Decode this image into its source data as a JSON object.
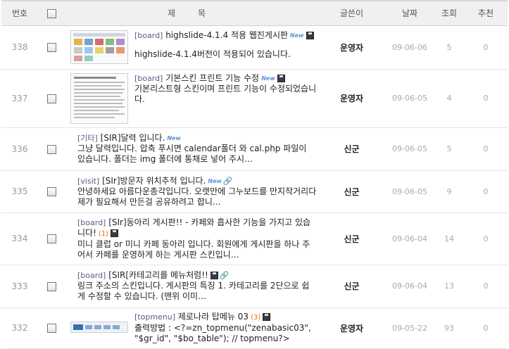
{
  "header": {
    "num": "번호",
    "title": "제 목",
    "writer": "글쓴이",
    "date": "날짜",
    "hits": "조회",
    "recommend": "추천"
  },
  "posts": [
    {
      "num": "338",
      "category": "[board]",
      "title": "highslide-4.1.4 적용 웹진게시판",
      "comments": "",
      "new": "New",
      "body": "highslide-4.1.4버전이 적용되어 있습니다.",
      "writer": "운영자",
      "date": "09-06-06",
      "hits": "5",
      "rec": "0"
    },
    {
      "num": "337",
      "category": "[board]",
      "title": "기본스킨 프린트 기능 수정",
      "comments": "",
      "new": "New",
      "body": "기본리스트형 스킨이며 프린트 기능이 수정되었습니다.",
      "writer": "운영자",
      "date": "09-06-05",
      "hits": "4",
      "rec": "0"
    },
    {
      "num": "336",
      "category": "[기타]",
      "title": "[SIR]달력 입니다.",
      "comments": "",
      "new": "New",
      "body": "그냥 달력입니다.  압축 푸시면 calendar폴더 와 cal.php 파일이 있습니다. 폴더는 img 폴더에 통채로 넣어 주시…",
      "writer": "신군",
      "date": "09-06-05",
      "hits": "5",
      "rec": "0"
    },
    {
      "num": "335",
      "category": "[visit]",
      "title": "[SIr]방문자 위치추적 입니다.",
      "comments": "",
      "new": "New",
      "body": "안녕하세요 아름다운총각입니다. 오랫만에 그누보드를 만지작거리다 제가 필요해서 만든걸 공유하려고 합니…",
      "writer": "신군",
      "date": "09-06-05",
      "hits": "9",
      "rec": "0"
    },
    {
      "num": "334",
      "category": "[board]",
      "title": "[SIr]동아리 게시판!! - 카페와 흡사한 기능을 가지고 있습니다!",
      "comments": "(1)",
      "new": "",
      "body": "미니 클럽 or 미니 카페 동아리 입니다. 회원에게 게시판을 하나 주어서 카페를 운영하게 하는 게시판 스킨입니…",
      "writer": "신군",
      "date": "09-06-04",
      "hits": "14",
      "rec": "0"
    },
    {
      "num": "333",
      "category": "[board]",
      "title": "[SIR[카테고리를 메뉴처럼!!",
      "comments": "",
      "new": "",
      "body": "링크 주소의 스킨입니다.   게시판의 특징 1. 카테고리를 2단으로 쉽게 수정할 수 있습니다. (맨위 이미…",
      "writer": "신군",
      "date": "09-06-04",
      "hits": "13",
      "rec": "0"
    },
    {
      "num": "332",
      "category": "[topmenu]",
      "title": "제로나라 탑메뉴 03",
      "comments": "(3)",
      "new": "",
      "body": "출력방법 : <?=zn_topmenu(\"zenabasic03\", \"$gr_id\", \"$bo_table\"); // topmenu?>",
      "writer": "운영자",
      "date": "09-05-22",
      "hits": "93",
      "rec": "0"
    }
  ]
}
